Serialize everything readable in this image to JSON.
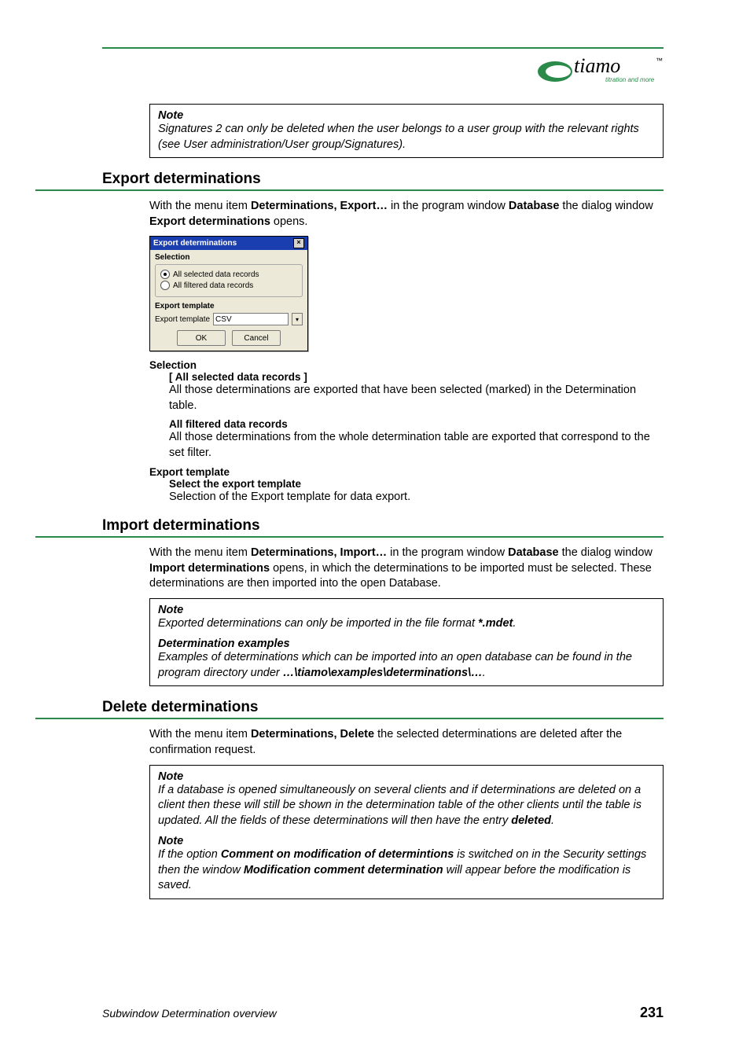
{
  "logo": {
    "brand": "tiamo",
    "tagline": "titration and more",
    "tm": "™"
  },
  "note_top": {
    "title": "Note",
    "text": "Signatures 2 can only be deleted when the user belongs to a user group with the relevant rights (see User administration/User group/Signatures)."
  },
  "export": {
    "heading": "Export determinations",
    "intro_prefix": "With the menu item ",
    "intro_bold1": "Determinations, Export…",
    "intro_mid": " in the program window ",
    "intro_bold2": "Database",
    "intro_mid2": " the dialog window ",
    "intro_bold3": "Export determinations",
    "intro_suffix": " opens.",
    "dialog": {
      "title": "Export determinations",
      "group_selection": "Selection",
      "radio1": "All selected data records",
      "radio2": "All filtered data records",
      "group_template": "Export template",
      "template_label": "Export template",
      "template_value": "CSV",
      "ok": "OK",
      "cancel": "Cancel"
    },
    "def_selection": "Selection",
    "def_selection_sub1": "[ All selected data records ]",
    "def_selection_text1": "All those determinations are exported that have been selected (marked) in the Determination table.",
    "def_selection_sub2": "All filtered data records",
    "def_selection_text2": "All those determinations from the whole determination table are exported that correspond to the set filter.",
    "def_template": "Export template",
    "def_template_sub": "Select the export template",
    "def_template_text": "Selection of the Export template for data export."
  },
  "import": {
    "heading": "Import determinations",
    "intro_prefix": "With the menu item ",
    "intro_bold1": "Determinations, Import…",
    "intro_mid": " in the program window ",
    "intro_bold2": "Database",
    "intro_mid2": " the dialog window ",
    "intro_bold3": "Import determinations",
    "intro_suffix": " opens, in which the determinations to be imported must be selected. These determinations are then imported into the open Database.",
    "note1_title": "Note",
    "note1_text": "Exported determinations can only be imported in the file format ",
    "note1_bold": "*.mdet",
    "note1_suffix": ".",
    "note2_title": "Determination examples",
    "note2_text": "Examples of determinations which can be imported into an open database can be found in the program directory under ",
    "note2_bold": "…\\tiamo\\examples\\determinations\\…",
    "note2_suffix": "."
  },
  "delete": {
    "heading": "Delete determinations",
    "intro_prefix": "With the menu item ",
    "intro_bold1": "Determinations, Delete",
    "intro_suffix": " the selected determinations are deleted after the confirmation request.",
    "note1_title": "Note",
    "note1_text": "If a database is opened simultaneously on several clients and if determinations are deleted on a client then these will still be shown in the determination table of the other clients until the table is updated. All the fields of these determinations will then have the entry ",
    "note1_bold": "deleted",
    "note1_suffix": ".",
    "note2_title": "Note",
    "note2_prefix": "If the option ",
    "note2_bold1": "Comment on modification of determintions",
    "note2_mid": " is switched on in the Security settings then the window ",
    "note2_bold2": "Modification comment determination",
    "note2_suffix": " will appear before the modification is saved."
  },
  "footer": {
    "left": "Subwindow Determination overview",
    "right": "231"
  }
}
